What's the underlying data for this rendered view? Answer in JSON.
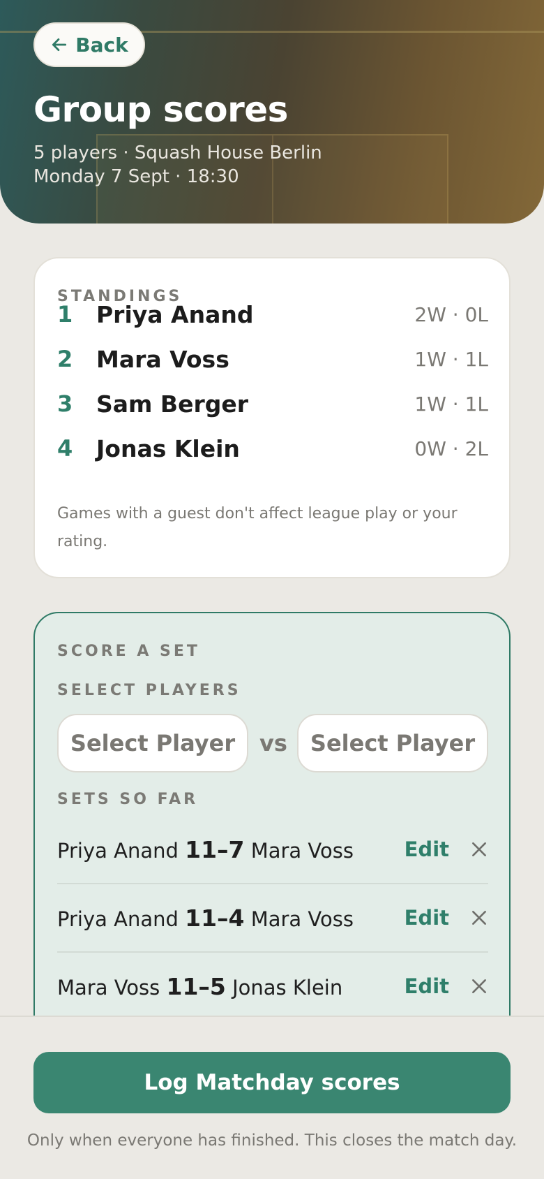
{
  "header": {
    "back_label": "Back",
    "title": "Group scores",
    "subtitle_line1": "5 players · Squash House Berlin",
    "subtitle_line2": "Monday 7 Sept · 18:30"
  },
  "standings": {
    "heading": "STANDINGS",
    "rows": [
      {
        "rank": "1",
        "name": "Priya Anand",
        "record": "2W · 0L"
      },
      {
        "rank": "2",
        "name": "Mara Voss",
        "record": "1W · 1L"
      },
      {
        "rank": "3",
        "name": "Sam Berger",
        "record": "1W · 1L"
      },
      {
        "rank": "4",
        "name": "Jonas Klein",
        "record": "0W · 2L"
      }
    ],
    "note": "Games with a guest don't affect league play or your rating."
  },
  "score_set": {
    "heading": "SCORE A SET",
    "select_heading": "SELECT PLAYERS",
    "player1_placeholder": "Select Player",
    "vs_label": "vs",
    "player2_placeholder": "Select Player",
    "sets_heading": "SETS SO FAR",
    "edit_label": "Edit",
    "sets": [
      {
        "p1": "Priya Anand",
        "score": "11–7",
        "p2": "Mara Voss"
      },
      {
        "p1": "Priya Anand",
        "score": "11–4",
        "p2": "Mara Voss"
      },
      {
        "p1": "Mara Voss",
        "score": "11–5",
        "p2": "Jonas Klein"
      }
    ]
  },
  "footer": {
    "log_button": "Log Matchday scores",
    "help_text": "Only when everyone has finished. This closes the match day."
  },
  "colors": {
    "accent": "#2f7a66",
    "button": "#3a8671",
    "background": "#ebe9e4"
  },
  "icons": {
    "back": "arrow-left-icon",
    "remove": "close-icon"
  }
}
